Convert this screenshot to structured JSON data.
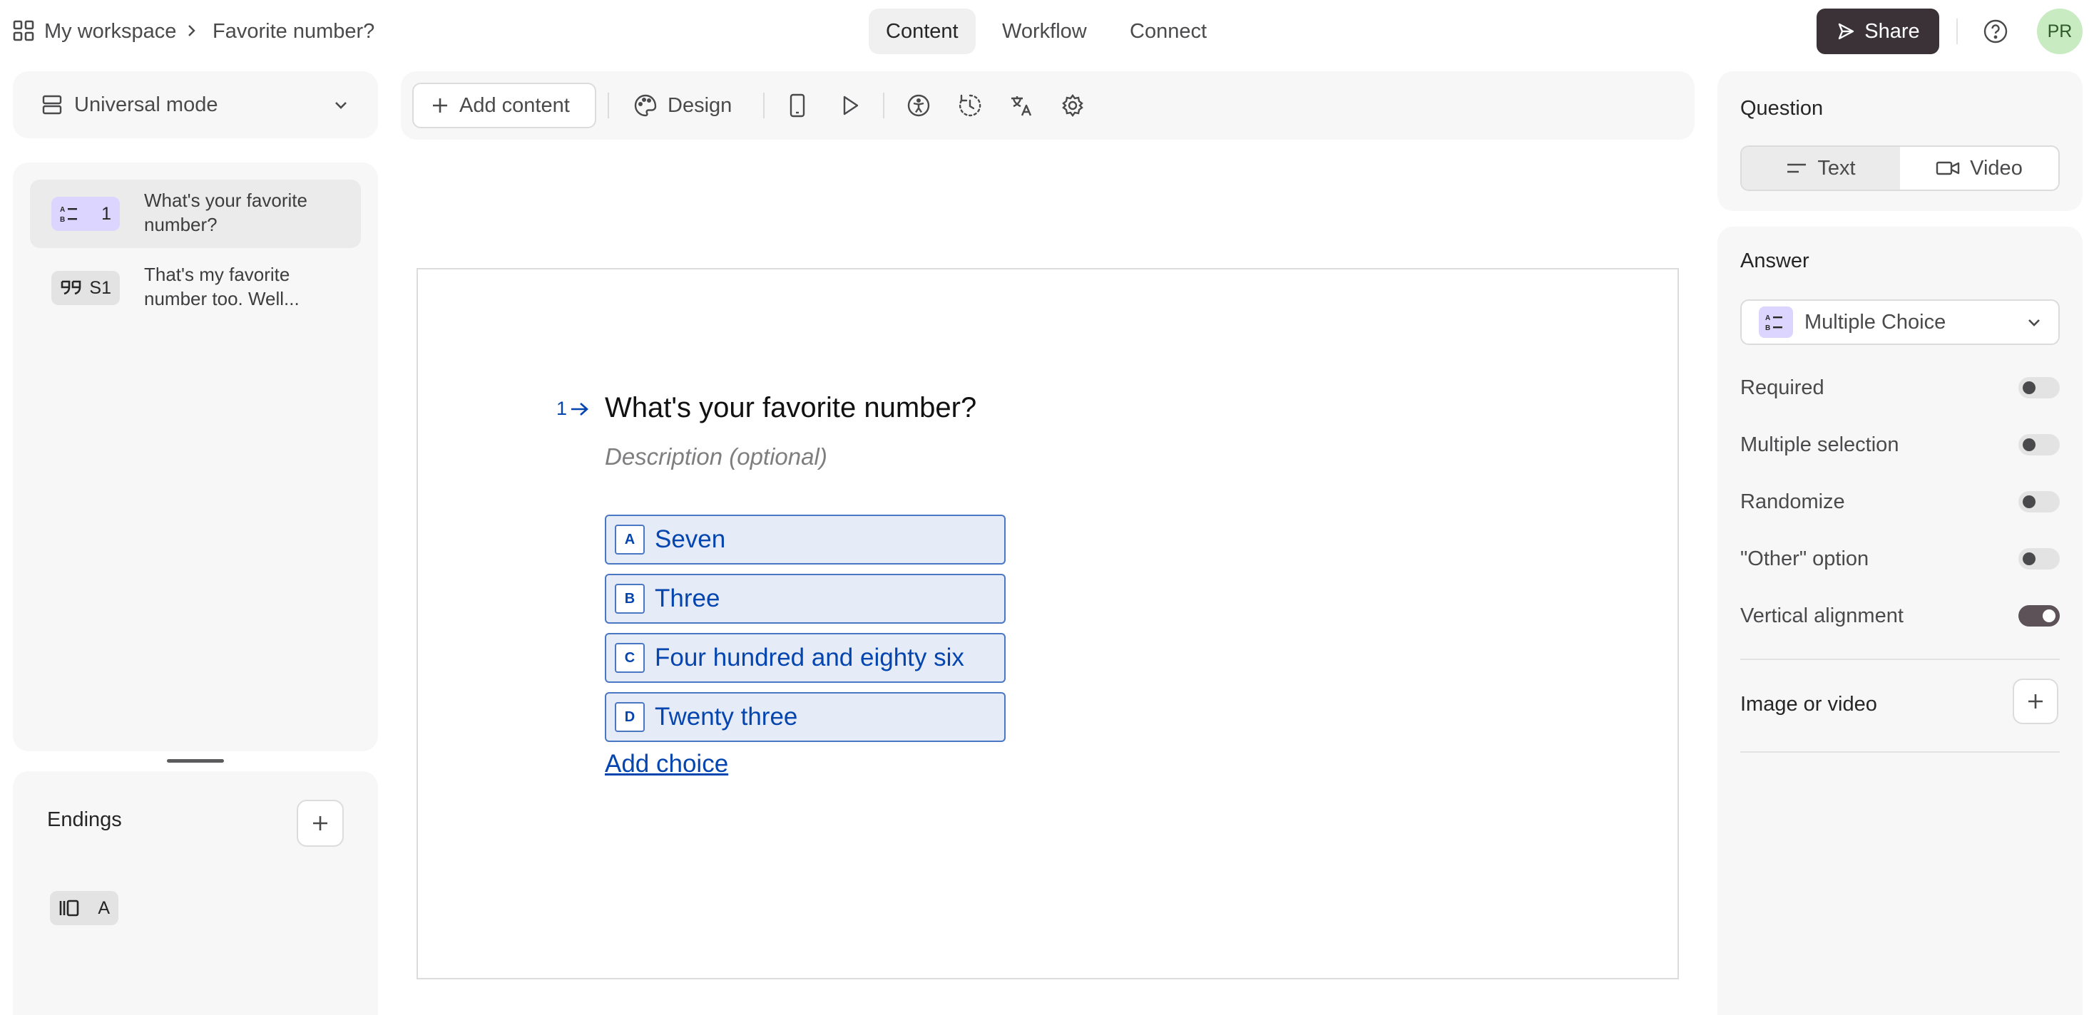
{
  "header": {
    "workspace": "My workspace",
    "form_title": "Favorite number?",
    "tabs": [
      {
        "label": "Content",
        "active": true
      },
      {
        "label": "Workflow",
        "active": false
      },
      {
        "label": "Connect",
        "active": false
      }
    ],
    "share_label": "Share",
    "avatar_initials": "PR"
  },
  "left": {
    "mode_label": "Universal mode",
    "blocks": [
      {
        "badge": "1",
        "title": "What's your favorite number?",
        "type_icon": "multiple-choice-icon",
        "selected": true
      },
      {
        "badge": "S1",
        "title": "That's my favorite number too. Well...",
        "type_icon": "quote-icon",
        "selected": false
      }
    ],
    "endings_title": "Endings",
    "endings": [
      {
        "badge": "A",
        "type_icon": "ending-icon"
      }
    ]
  },
  "toolbar": {
    "add_content_label": "Add content",
    "design_label": "Design",
    "tools": [
      "mobile-preview-icon",
      "play-icon",
      "accessibility-icon",
      "history-icon",
      "translate-icon",
      "settings-icon"
    ]
  },
  "canvas": {
    "question_number": "1",
    "question_title": "What's your favorite number?",
    "description_placeholder": "Description (optional)",
    "choices": [
      {
        "key": "A",
        "label": "Seven"
      },
      {
        "key": "B",
        "label": "Three"
      },
      {
        "key": "C",
        "label": "Four hundred and eighty six"
      },
      {
        "key": "D",
        "label": "Twenty three"
      }
    ],
    "add_choice_label": "Add choice"
  },
  "right": {
    "question_title": "Question",
    "question_types": [
      {
        "label": "Text",
        "active": true
      },
      {
        "label": "Video",
        "active": false
      }
    ],
    "answer_title": "Answer",
    "answer_type": "Multiple Choice",
    "settings": [
      {
        "label": "Required",
        "on": false
      },
      {
        "label": "Multiple selection",
        "on": false
      },
      {
        "label": "Randomize",
        "on": false
      },
      {
        "label": "\"Other\" option",
        "on": false
      },
      {
        "label": "Vertical alignment",
        "on": true
      }
    ],
    "media_title": "Image or video"
  },
  "colors": {
    "accent_blue": "#0445af",
    "choice_bg": "#e6ecf7",
    "share_bg": "#3b3237",
    "mc_badge": "#dcd5ff",
    "avatar_bg": "#c8ebc2"
  }
}
